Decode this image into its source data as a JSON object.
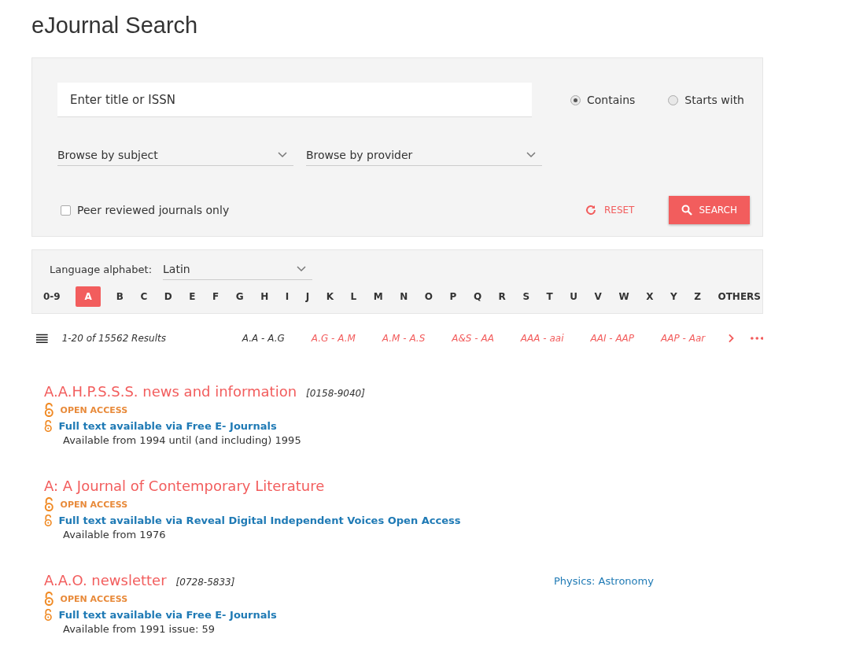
{
  "page_title": "eJournal Search",
  "search": {
    "placeholder": "Enter title or ISSN",
    "match_options": [
      {
        "label": "Contains",
        "selected": true
      },
      {
        "label": "Starts with",
        "selected": false
      }
    ],
    "browse_subject": "Browse by subject",
    "browse_provider": "Browse by provider",
    "peer_reviewed": {
      "label": "Peer reviewed journals only",
      "checked": false
    },
    "reset": "RESET",
    "search": "SEARCH"
  },
  "alphabet": {
    "label": "Language alphabet:",
    "value": "Latin",
    "letters": [
      {
        "label": "0-9",
        "selected": false
      },
      {
        "label": "A",
        "selected": true
      },
      {
        "label": "B",
        "selected": false
      },
      {
        "label": "C",
        "selected": false
      },
      {
        "label": "D",
        "selected": false
      },
      {
        "label": "E",
        "selected": false
      },
      {
        "label": "F",
        "selected": false
      },
      {
        "label": "G",
        "selected": false
      },
      {
        "label": "H",
        "selected": false
      },
      {
        "label": "I",
        "selected": false
      },
      {
        "label": "J",
        "selected": false
      },
      {
        "label": "K",
        "selected": false
      },
      {
        "label": "L",
        "selected": false
      },
      {
        "label": "M",
        "selected": false
      },
      {
        "label": "N",
        "selected": false
      },
      {
        "label": "O",
        "selected": false
      },
      {
        "label": "P",
        "selected": false
      },
      {
        "label": "Q",
        "selected": false
      },
      {
        "label": "R",
        "selected": false
      },
      {
        "label": "S",
        "selected": false
      },
      {
        "label": "T",
        "selected": false
      },
      {
        "label": "U",
        "selected": false
      },
      {
        "label": "V",
        "selected": false
      },
      {
        "label": "W",
        "selected": false
      },
      {
        "label": "X",
        "selected": false
      },
      {
        "label": "Y",
        "selected": false
      },
      {
        "label": "Z",
        "selected": false
      },
      {
        "label": "OTHERS",
        "selected": false
      }
    ]
  },
  "results_bar": {
    "count": "1-20 of 15562 Results",
    "ranges": [
      {
        "label": "A.A - A.G",
        "selected": true
      },
      {
        "label": "A.G - A.M",
        "selected": false
      },
      {
        "label": "A.M - A.S",
        "selected": false
      },
      {
        "label": "A&S - AA",
        "selected": false
      },
      {
        "label": "AAA - aai",
        "selected": false
      },
      {
        "label": "AAI - AAP",
        "selected": false
      },
      {
        "label": "AAP - Aar",
        "selected": false
      }
    ]
  },
  "results": [
    {
      "title": "A.A.H.P.S.S.S. news and information",
      "issn": "[0158-9040]",
      "access": "OPEN ACCESS",
      "link": "Full text available via Free E- Journals",
      "availability": "Available from 1994 until (and including) 1995"
    },
    {
      "title": "A: A Journal of Contemporary Literature",
      "access": "OPEN ACCESS",
      "link": "Full text available via Reveal Digital Independent Voices Open Access",
      "availability": "Available from 1976"
    },
    {
      "title": "A.A.O. newsletter",
      "issn": "[0728-5833]",
      "access": "OPEN ACCESS",
      "link": "Full text available via Free E- Journals",
      "availability": "Available from 1991 issue: 59",
      "subject": "Physics: Astronomy"
    }
  ]
}
